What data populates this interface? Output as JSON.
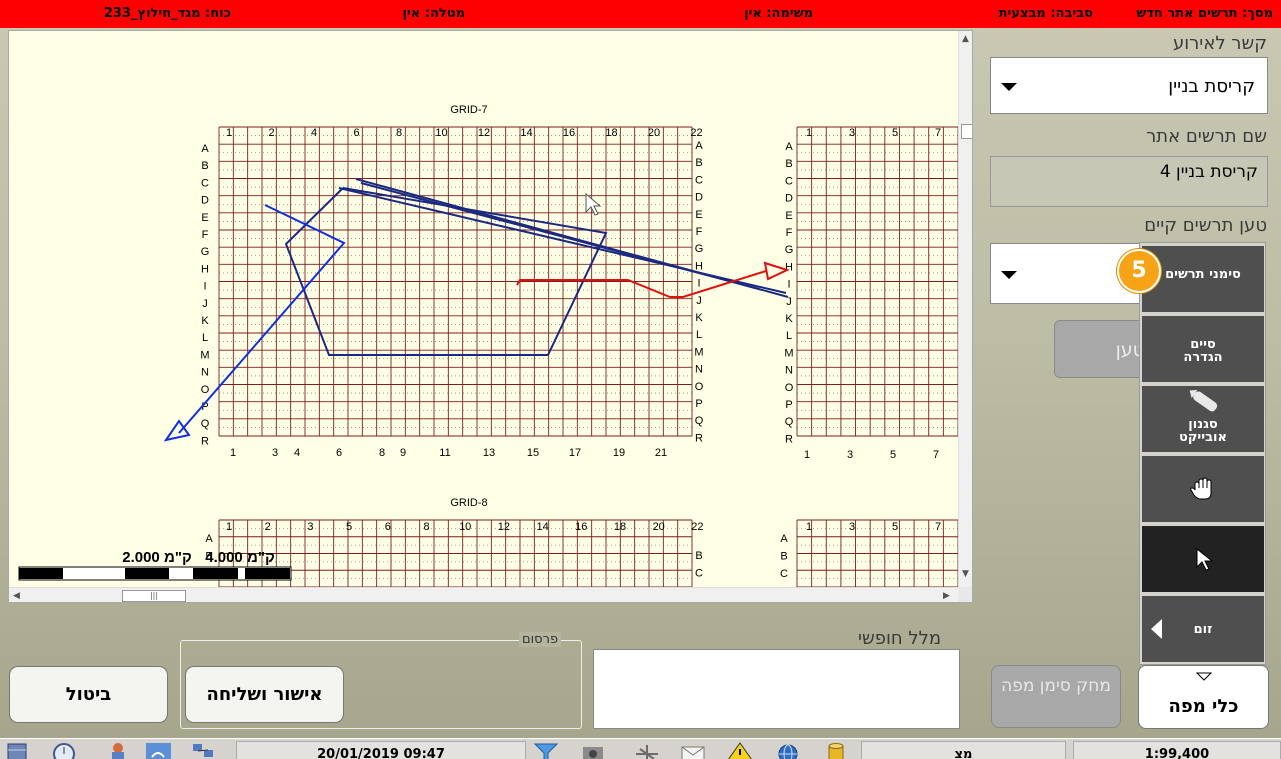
{
  "status_bar": {
    "screen": "מסך: תרשים אתר חדש",
    "environment": "סביבה: מבצעית",
    "task": "משימה: אין",
    "mission": "מטלה: אין",
    "force": "כוח: מגד_חילוץ_233"
  },
  "map": {
    "grids": [
      {
        "title": "GRID-7",
        "top_numbers": [
          "1",
          "2",
          "4",
          "6",
          "8",
          "10",
          "12",
          "14",
          "16",
          "18",
          "20",
          "22"
        ],
        "bottom_numbers": [
          "1",
          "3",
          "4",
          "6",
          "8",
          "9",
          "11",
          "13",
          "15",
          "17",
          "19",
          "21"
        ],
        "row_letters": [
          "A",
          "B",
          "C",
          "D",
          "E",
          "F",
          "G",
          "H",
          "I",
          "J",
          "K",
          "L",
          "M",
          "N",
          "O",
          "P",
          "Q",
          "R"
        ]
      },
      {
        "title": "GRID-8",
        "top_numbers": [
          "1",
          "2",
          "3",
          "5",
          "6",
          "8",
          "10",
          "12",
          "14",
          "16",
          "18",
          "20",
          "22"
        ],
        "row_letters": [
          "A",
          "B",
          "C"
        ]
      }
    ],
    "side_grid": {
      "top_numbers": [
        "1",
        "3",
        "5",
        "7"
      ],
      "bottom_numbers": [
        "1",
        "3",
        "5",
        "7"
      ],
      "row_letters": [
        "A",
        "B",
        "C",
        "D",
        "E",
        "F",
        "G",
        "H",
        "I",
        "J",
        "K",
        "L",
        "M",
        "N",
        "O",
        "P",
        "Q",
        "R"
      ]
    },
    "scale_labels": [
      "2.000 ק\"מ",
      "4.000 ק\"מ"
    ],
    "scroll_thumb_glyph": "|||",
    "colors": {
      "background": "#ffffe6",
      "grid_line": "#7a1f1f",
      "navy_shape": "#1a2a80",
      "blue_arrow": "#1030e0",
      "red_arrow": "#e01010"
    }
  },
  "form": {
    "event_link_label": "קשר לאירוע",
    "event_link_value": "קריסת בניין",
    "site_name_label": "שם תרשים אתר",
    "site_name_value": "קריסת בניין 4",
    "load_existing_label": "טען תרשים קיים",
    "load_existing_value": "",
    "load_button_partial": "טען"
  },
  "toolbar": {
    "badge_number": "5",
    "tools": [
      {
        "label": "סימני תרשים",
        "icon": ""
      },
      {
        "label": "סיים הגדרה",
        "icon": ""
      },
      {
        "label": "סגנון אובייקט",
        "icon": "pencil-icon"
      },
      {
        "label": "",
        "icon": "hand-icon"
      },
      {
        "label": "",
        "icon": "cursor-icon"
      },
      {
        "label": "זום",
        "icon": "triangle-left-icon"
      }
    ]
  },
  "bottom": {
    "cancel_label": "ביטול",
    "approve_label": "אישור ושליחה",
    "publish_label": "פרסום",
    "free_text_label": "מלל חופשי",
    "free_text_value": "",
    "delete_mark_label": "מחק סימן מפה",
    "map_tools_label": "כלי מפה"
  },
  "taskbar": {
    "datetime": "20/01/2019 09:47",
    "field2": "מצ",
    "scale": "1:99,400"
  }
}
